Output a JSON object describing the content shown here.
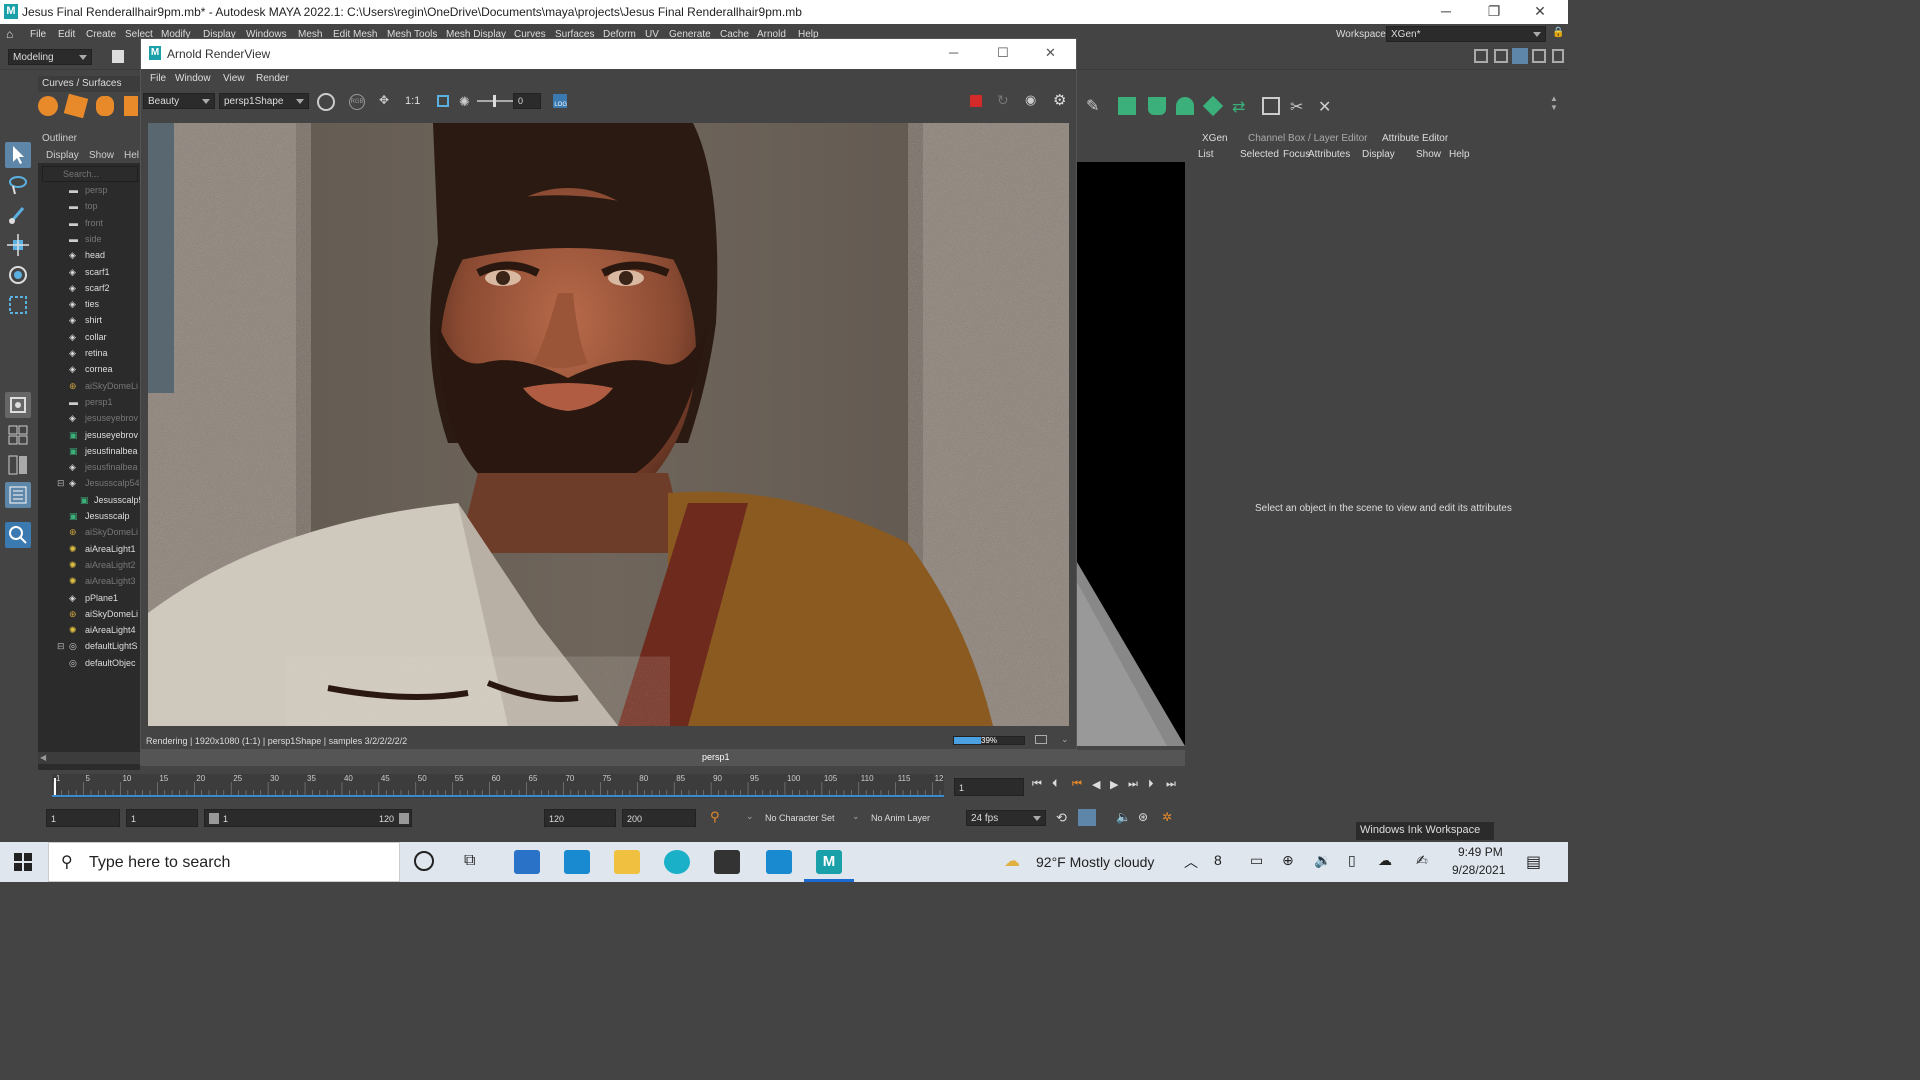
{
  "window": {
    "title": "Jesus Final Renderallhair9pm.mb* - Autodesk MAYA 2022.1: C:\\Users\\regin\\OneDrive\\Documents\\maya\\projects\\Jesus Final Renderallhair9pm.mb"
  },
  "menu": [
    "File",
    "Edit",
    "Create",
    "Select",
    "Modify",
    "Display",
    "Windows",
    "Mesh",
    "Edit Mesh",
    "Mesh Tools",
    "Mesh Display",
    "Curves",
    "Surfaces",
    "Deform",
    "UV",
    "Generate",
    "Cache",
    "Arnold",
    "Help"
  ],
  "workspace": {
    "label": "Workspace:",
    "value": "XGen*"
  },
  "mode_dropdown": "Modeling",
  "shelf_tab": "Curves / Surfaces",
  "outliner": {
    "title": "Outliner",
    "menu": [
      "Display",
      "Show",
      "Hel"
    ],
    "search_placeholder": "Search...",
    "items": [
      {
        "label": "persp",
        "dim": true,
        "icon": "camera"
      },
      {
        "label": "top",
        "dim": true,
        "icon": "camera"
      },
      {
        "label": "front",
        "dim": true,
        "icon": "camera"
      },
      {
        "label": "side",
        "dim": true,
        "icon": "camera"
      },
      {
        "label": "head",
        "dim": false,
        "icon": "mesh"
      },
      {
        "label": "scarf1",
        "dim": false,
        "icon": "mesh"
      },
      {
        "label": "scarf2",
        "dim": false,
        "icon": "mesh"
      },
      {
        "label": "ties",
        "dim": false,
        "icon": "mesh"
      },
      {
        "label": "shirt",
        "dim": false,
        "icon": "mesh"
      },
      {
        "label": "collar",
        "dim": false,
        "icon": "mesh"
      },
      {
        "label": "retina",
        "dim": false,
        "icon": "mesh"
      },
      {
        "label": "cornea",
        "dim": false,
        "icon": "mesh"
      },
      {
        "label": "aiSkyDomeLi",
        "dim": true,
        "icon": "dome"
      },
      {
        "label": "persp1",
        "dim": true,
        "icon": "camera"
      },
      {
        "label": "jesuseyebrov",
        "dim": true,
        "icon": "mesh"
      },
      {
        "label": "jesuseyebrov",
        "dim": false,
        "icon": "xgen"
      },
      {
        "label": "jesusfinalbea",
        "dim": false,
        "icon": "xgen"
      },
      {
        "label": "jesusfinalbea",
        "dim": true,
        "icon": "mesh"
      },
      {
        "label": "Jesusscalp54",
        "dim": true,
        "icon": "mesh"
      },
      {
        "label": "Jesusscalp54",
        "dim": false,
        "icon": "xgen"
      },
      {
        "label": "Jesusscalp",
        "dim": false,
        "icon": "xgen"
      },
      {
        "label": "aiSkyDomeLi",
        "dim": true,
        "icon": "dome"
      },
      {
        "label": "aiAreaLight1",
        "dim": false,
        "icon": "light"
      },
      {
        "label": "aiAreaLight2",
        "dim": true,
        "icon": "light"
      },
      {
        "label": "aiAreaLight3",
        "dim": true,
        "icon": "light"
      },
      {
        "label": "pPlane1",
        "dim": false,
        "icon": "mesh"
      },
      {
        "label": "aiSkyDomeLi",
        "dim": false,
        "icon": "dome"
      },
      {
        "label": "aiAreaLight4",
        "dim": false,
        "icon": "light"
      },
      {
        "label": "defaultLightS",
        "dim": false,
        "icon": "set"
      },
      {
        "label": "defaultObjec",
        "dim": false,
        "icon": "set"
      }
    ]
  },
  "renderview": {
    "title": "Arnold RenderView",
    "menu": [
      "File",
      "Window",
      "View",
      "Render"
    ],
    "aov": "Beauty",
    "camera": "persp1Shape",
    "ratio": "1:1",
    "exposure": "0",
    "status": "Rendering | 1920x1080 (1:1) | persp1Shape | samples 3/2/2/2/2/2",
    "progress_label": "39%",
    "progress": 0.39
  },
  "viewport_label": "persp1",
  "right_tabs": [
    "XGen",
    "Channel Box / Layer Editor",
    "Attribute Editor"
  ],
  "attr_menu": [
    "List",
    "Selected",
    "Focus",
    "Attributes",
    "Display",
    "Show",
    "Help"
  ],
  "attr_message": "Select an object in the scene to view and edit its attributes",
  "timeline": {
    "ticks": [
      "1",
      "5",
      "10",
      "15",
      "20",
      "25",
      "30",
      "35",
      "40",
      "45",
      "50",
      "55",
      "60",
      "65",
      "70",
      "75",
      "80",
      "85",
      "90",
      "95",
      "100",
      "105",
      "110",
      "115",
      "12"
    ],
    "current_frame": "1"
  },
  "range": {
    "start": "1",
    "anim_start": "1",
    "slider_start": "1",
    "slider_end": "120",
    "anim_end": "120",
    "end": "200",
    "character_set": "No Character Set",
    "anim_layer": "No Anim Layer",
    "fps": "24 fps"
  },
  "ink_workspace": "Windows Ink Workspace",
  "taskbar": {
    "search_placeholder": "Type here to search",
    "weather": "92°F  Mostly cloudy",
    "time": "9:49 PM",
    "date": "9/28/2021"
  }
}
